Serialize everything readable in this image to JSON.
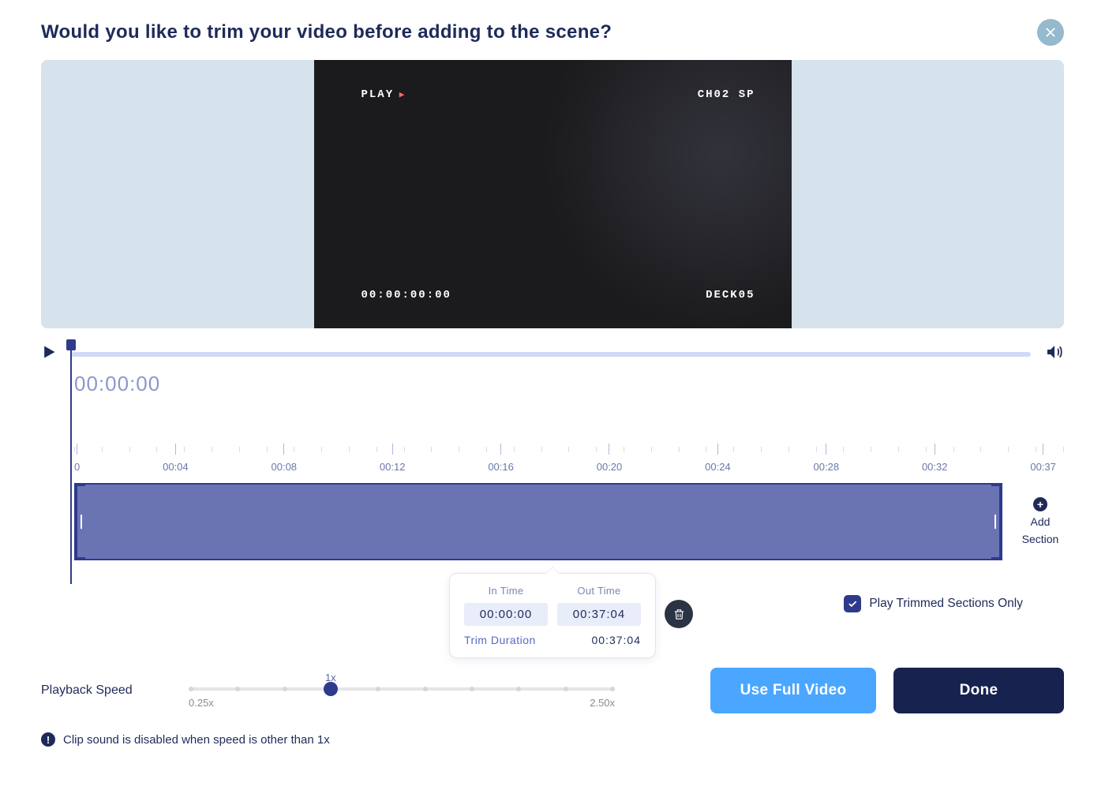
{
  "header": {
    "title": "Would you like to trim your video before adding to the scene?"
  },
  "video_overlay": {
    "play": "PLAY",
    "channel": "CH02 SP",
    "timecode": "00:00:00:00",
    "deck": "DECK05"
  },
  "playback": {
    "current_time": "00:00:00"
  },
  "ruler": {
    "ticks": [
      "0",
      "00:04",
      "00:08",
      "00:12",
      "00:16",
      "00:20",
      "00:24",
      "00:28",
      "00:32",
      "00:37"
    ]
  },
  "add_section": {
    "line1": "Add",
    "line2": "Section"
  },
  "trim_popover": {
    "in_label": "In Time",
    "out_label": "Out Time",
    "in_value": "00:00:00",
    "out_value": "00:37:04",
    "duration_label": "Trim Duration",
    "duration_value": "00:37:04"
  },
  "play_trimmed": {
    "label": "Play Trimmed Sections Only",
    "checked": true
  },
  "speed": {
    "label": "Playback Speed",
    "current": "1x",
    "min": "0.25x",
    "max": "2.50x"
  },
  "buttons": {
    "use_full": "Use Full Video",
    "done": "Done"
  },
  "warning": "Clip sound is disabled when speed is other than 1x"
}
